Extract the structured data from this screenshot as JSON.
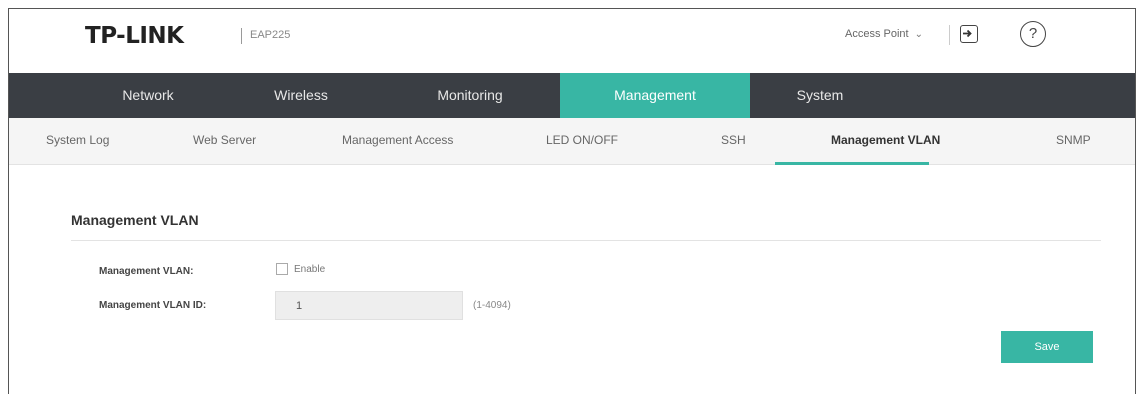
{
  "header": {
    "brand": "TP-LINK",
    "model": "EAP225",
    "mode_label": "Access Point",
    "mode_icon": "chevron-down-icon",
    "logout_icon": "logout-icon",
    "help_label": "?"
  },
  "mainnav": {
    "items": [
      {
        "label": "Network"
      },
      {
        "label": "Wireless"
      },
      {
        "label": "Monitoring"
      },
      {
        "label": "Management",
        "active": true
      },
      {
        "label": "System"
      }
    ]
  },
  "subnav": {
    "items": [
      {
        "label": "System Log"
      },
      {
        "label": "Web Server"
      },
      {
        "label": "Management Access"
      },
      {
        "label": "LED ON/OFF"
      },
      {
        "label": "SSH"
      },
      {
        "label": "Management VLAN",
        "active": true
      },
      {
        "label": "SNMP"
      }
    ]
  },
  "content": {
    "title": "Management VLAN",
    "vlan_label": "Management VLAN:",
    "enable_label": "Enable",
    "enable_checked": false,
    "vlan_id_label": "Management VLAN ID:",
    "vlan_id_value": "1",
    "range_hint": "(1-4094)",
    "save_label": "Save"
  },
  "colors": {
    "accent": "#38b6a4",
    "nav_bg": "#3a3e44",
    "subnav_bg": "#f5f5f5"
  }
}
